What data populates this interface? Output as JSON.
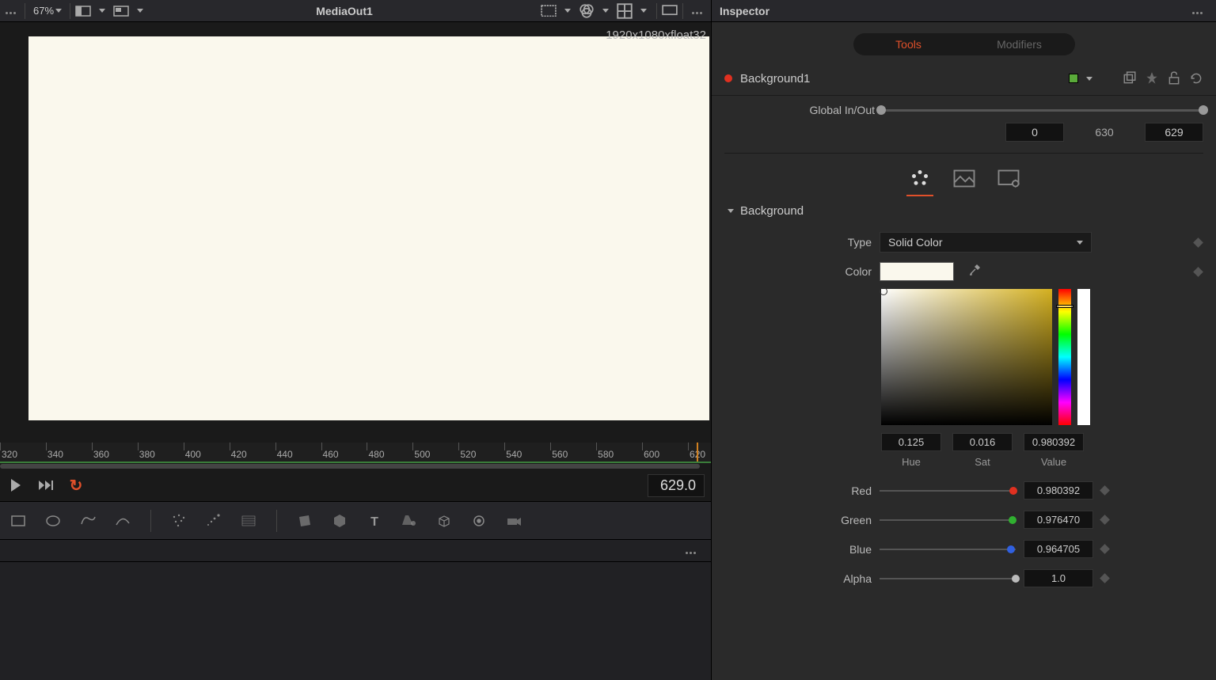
{
  "toolbar": {
    "zoom": "67%",
    "title": "MediaOut1"
  },
  "viewer": {
    "resolution": "1920x1080xfloat32",
    "canvas_color": "#faf8ed"
  },
  "timeline": {
    "marks": [
      320,
      340,
      360,
      380,
      400,
      420,
      440,
      460,
      480,
      500,
      520,
      540,
      560,
      580,
      600,
      620
    ],
    "current": "629.0"
  },
  "inspector": {
    "title": "Inspector",
    "tabs": {
      "tools": "Tools",
      "modifiers": "Modifiers"
    },
    "node_name": "Background1",
    "global_label": "Global In/Out",
    "global_in": "0",
    "global_mid": "630",
    "global_out": "629",
    "section_title": "Background",
    "type_label": "Type",
    "type_value": "Solid Color",
    "color_label": "Color",
    "hsv": {
      "hue": "0.125",
      "sat": "0.016",
      "val": "0.980392",
      "hue_lbl": "Hue",
      "sat_lbl": "Sat",
      "val_lbl": "Value"
    },
    "rgb": {
      "red_lbl": "Red",
      "red_val": "0.980392",
      "green_lbl": "Green",
      "green_val": "0.976470",
      "blue_lbl": "Blue",
      "blue_val": "0.964705",
      "alpha_lbl": "Alpha",
      "alpha_val": "1.0"
    }
  }
}
